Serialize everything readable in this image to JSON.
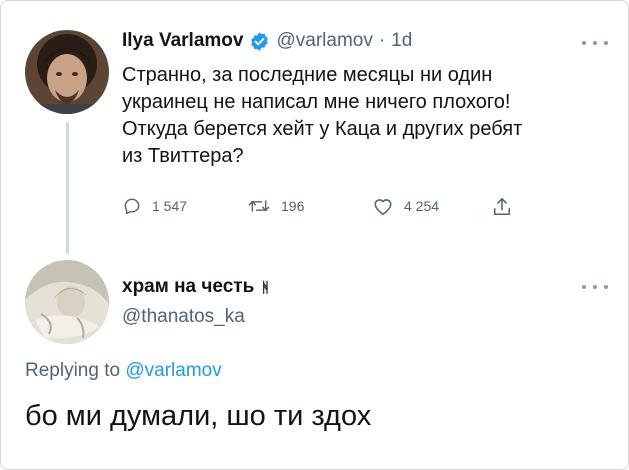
{
  "tweet": {
    "author_name": "Ilya Varlamov",
    "handle": "@varlamov",
    "separator": "·",
    "time": "1d",
    "text_lines": [
      "Странно, за последние месяцы ни один",
      "украинец не написал мне ничего плохого!",
      "Откуда берется хейт у Каца и других ребят",
      "из Твиттера?"
    ],
    "actions": {
      "replies": "1 547",
      "retweets": "196",
      "likes": "4 254"
    },
    "verified_color": "#1d9bf0"
  },
  "reply": {
    "author_name": "храм на честь",
    "name_glyph": "ᚻ",
    "handle": "@thanatos_ka",
    "replying_prefix": "Replying to",
    "replying_to": "@varlamov",
    "text": "бо ми думали, шо ти здох",
    "link_color": "#1d9bf0"
  },
  "icons": {
    "more": "more-horizontal-icon",
    "reply": "reply-bubble-icon",
    "retweet": "retweet-icon",
    "like": "heart-icon",
    "share": "share-upload-icon",
    "verified": "verified-badge-icon"
  }
}
